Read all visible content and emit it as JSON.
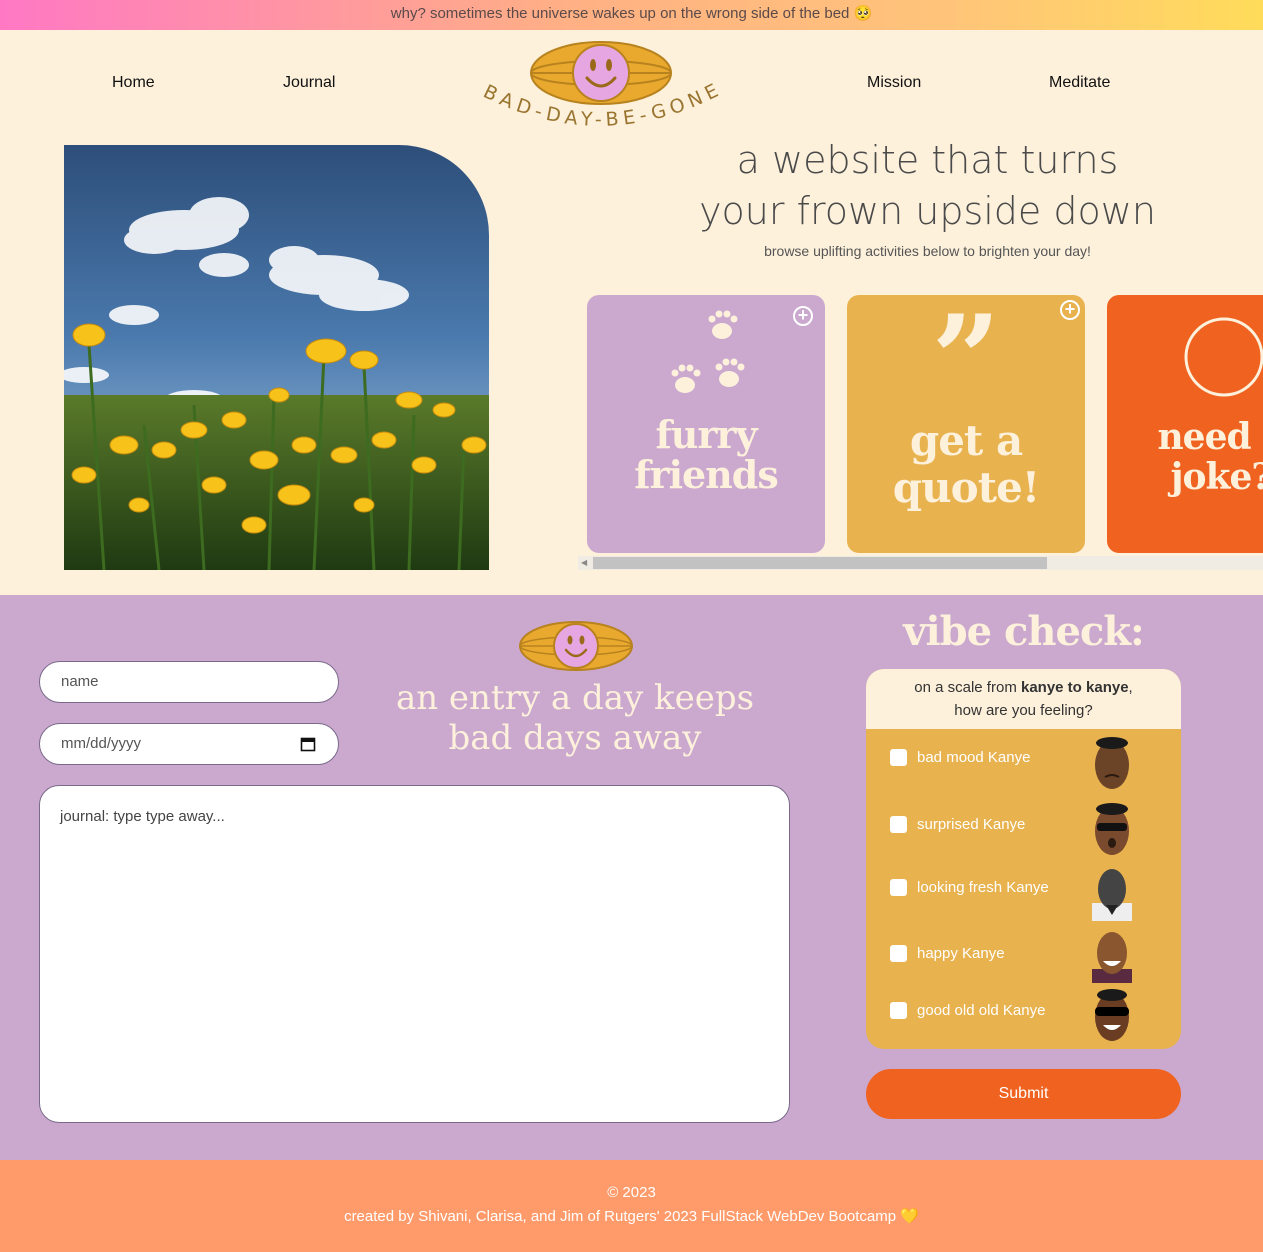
{
  "banner": {
    "text": "why? sometimes the universe wakes up on the wrong side of the bed 🥺"
  },
  "nav": {
    "home": "Home",
    "journal": "Journal",
    "mission": "Mission",
    "meditate": "Meditate",
    "logo_text": "BAD-DAY-BE-GONE"
  },
  "hero": {
    "headline_1": "a website that turns",
    "headline_2": "your frown upside down",
    "subline": "browse uplifting activities below to brighten your day!"
  },
  "cards": [
    {
      "label_1": "furry",
      "label_2": "friends",
      "color": "#cba9cf",
      "icon": "paw-prints-icon"
    },
    {
      "label_1": "get a",
      "label_2": "quote!",
      "color": "#e8b24e",
      "icon": "quote-mark-icon"
    },
    {
      "label_1": "need a",
      "label_2": "joke?",
      "color": "#f0621f",
      "icon": "circle-icon"
    }
  ],
  "journal": {
    "name_placeholder": "name",
    "date_placeholder": "mm/dd/yyyy",
    "entry_placeholder": "journal: type type away...",
    "title_1": "an entry a day keeps",
    "title_2": "bad days away"
  },
  "vibe": {
    "title": "vibe check:",
    "prompt_prefix": "on a scale from ",
    "prompt_bold": "kanye to kanye",
    "prompt_suffix": ",",
    "prompt_line2": "how are you feeling?",
    "options": [
      "bad mood Kanye",
      "surprised Kanye",
      "looking fresh Kanye",
      "happy Kanye",
      "good old old Kanye"
    ],
    "submit": "Submit"
  },
  "footer": {
    "copyright": "© 2023",
    "credits": "created by Shivani, Clarisa, and Jim of Rutgers' 2023 FullStack WebDev Bootcamp 💛"
  },
  "colors": {
    "cream": "#fdf1dc",
    "lavender": "#cba9cf",
    "mustard": "#e8b24e",
    "orange": "#f0621f",
    "footer": "#ff9b6a"
  }
}
